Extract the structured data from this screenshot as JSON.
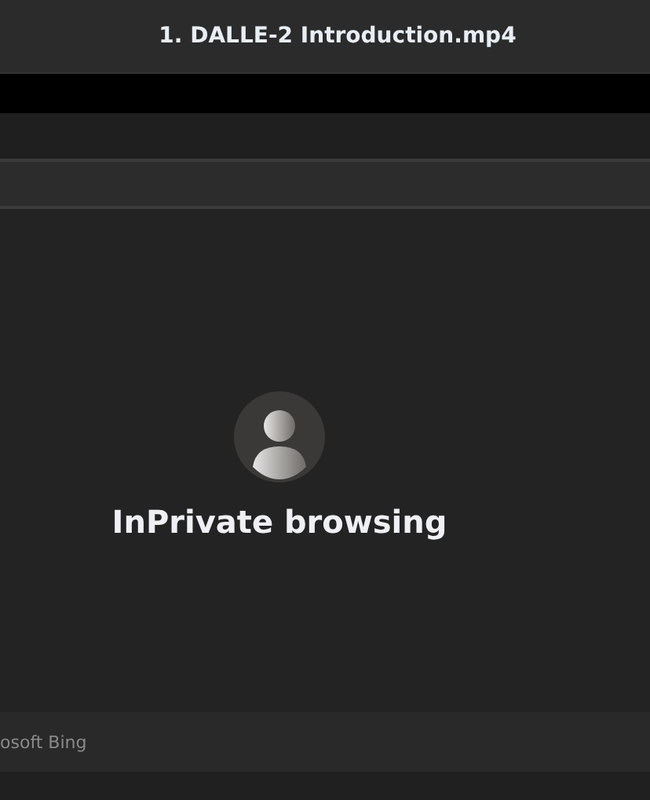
{
  "window": {
    "title": "1. DALLE-2 Introduction.mp4"
  },
  "page": {
    "heading": "InPrivate browsing"
  },
  "footer": {
    "text": "osoft Bing"
  }
}
